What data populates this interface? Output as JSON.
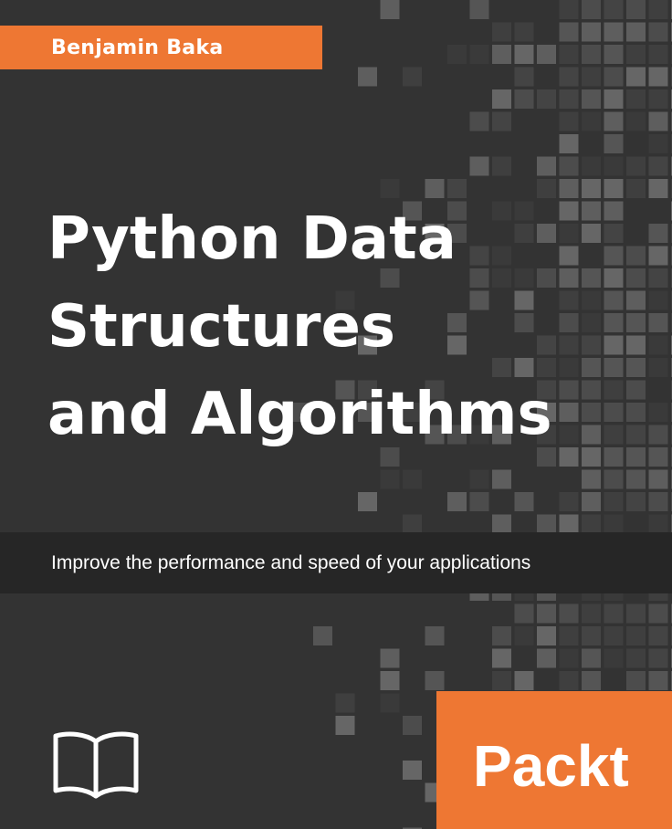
{
  "cover": {
    "author": "Benjamin Baka",
    "title_lines": [
      "Python Data",
      "Structures",
      "and Algorithms"
    ],
    "subtitle": "Improve the performance and speed of your applications",
    "publisher": "Packt",
    "colors": {
      "background": "#333333",
      "accent_orange": "#ee7733",
      "band_dark": "#262626",
      "text": "#ffffff"
    },
    "icons": [
      "open-book-icon",
      "packt-logo"
    ]
  }
}
